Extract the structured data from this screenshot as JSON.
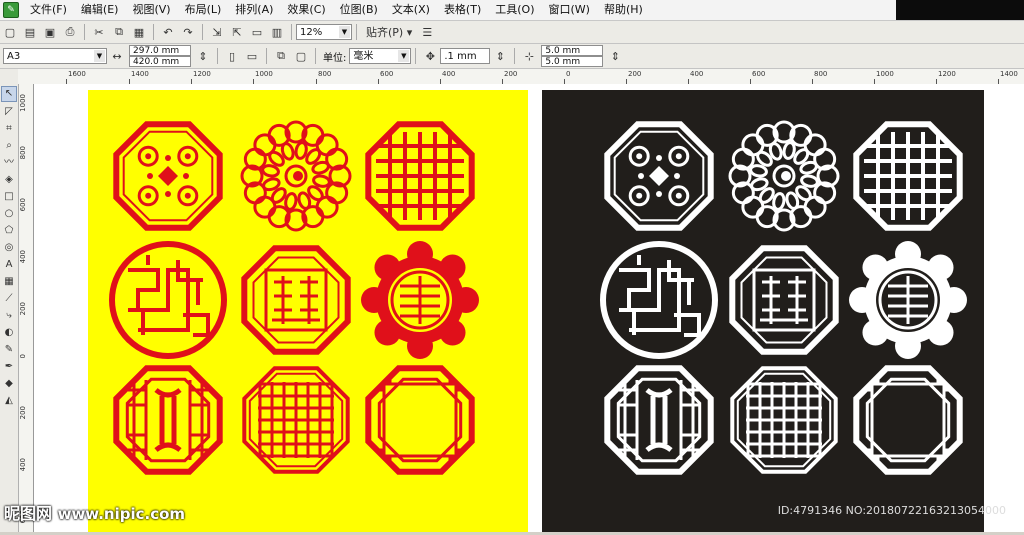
{
  "menubar": {
    "items": [
      "文件(F)",
      "编辑(E)",
      "视图(V)",
      "布局(L)",
      "排列(A)",
      "效果(C)",
      "位图(B)",
      "文本(X)",
      "表格(T)",
      "工具(O)",
      "窗口(W)",
      "帮助(H)"
    ]
  },
  "toolbar1": {
    "zoom_value": "12%",
    "snap_label": "贴齐(P)"
  },
  "toolbar2": {
    "page_size": "A3",
    "page_width": "297.0 mm",
    "page_height": "420.0 mm",
    "unit_label": "单位:",
    "unit_value": "毫米",
    "nudge_value": ".1 mm",
    "dup_x": "5.0 mm",
    "dup_y": "5.0 mm"
  },
  "ruler_h": [
    "1600",
    "1400",
    "1200",
    "1000",
    "800",
    "600",
    "400",
    "200",
    "0",
    "200",
    "400",
    "600",
    "800",
    "1000",
    "1200",
    "1400"
  ],
  "ruler_v": [
    "1000",
    "800",
    "600",
    "400",
    "200",
    "0",
    "200",
    "400",
    "600"
  ],
  "colors": {
    "yellow_page": "#ffff00",
    "black_page": "#211e1b",
    "red_pattern": "#e0101a",
    "white_pattern": "#ffffff"
  },
  "watermark": {
    "site": "昵图网",
    "url": "www.nipic.com",
    "id_text": "ID:4791346 NO:20180722163213054000"
  }
}
